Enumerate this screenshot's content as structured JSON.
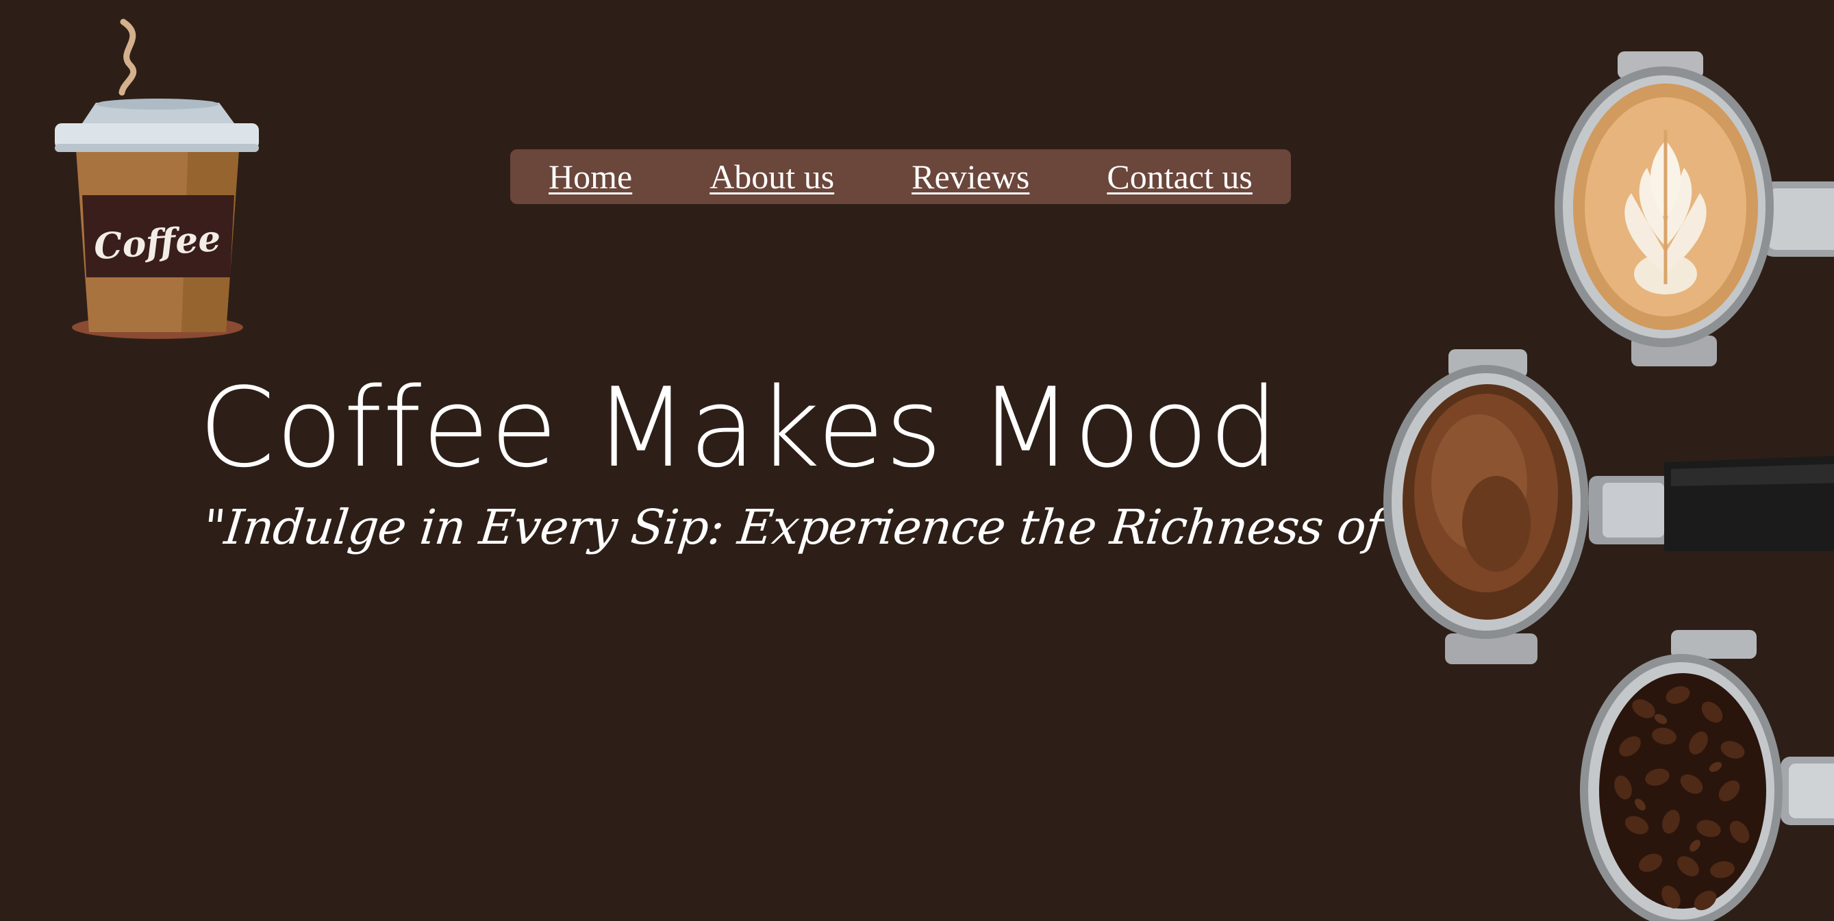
{
  "page": {
    "background": "#2d1f17",
    "accent": "#6b463b"
  },
  "logo": {
    "icon": "coffee-cup-icon",
    "text": "Coffee"
  },
  "nav": {
    "items": [
      {
        "label": "Home"
      },
      {
        "label": "About us"
      },
      {
        "label": "Reviews"
      },
      {
        "label": "Contact us"
      }
    ]
  },
  "hero": {
    "title": "Coffee Makes Mood",
    "tagline": "\"Indulge in Every Sip: Experience the Richness of Coffee!\""
  },
  "decor": {
    "images": [
      "latte-portafilter-image",
      "ground-coffee-portafilter-image",
      "coffee-beans-portafilter-image"
    ]
  }
}
